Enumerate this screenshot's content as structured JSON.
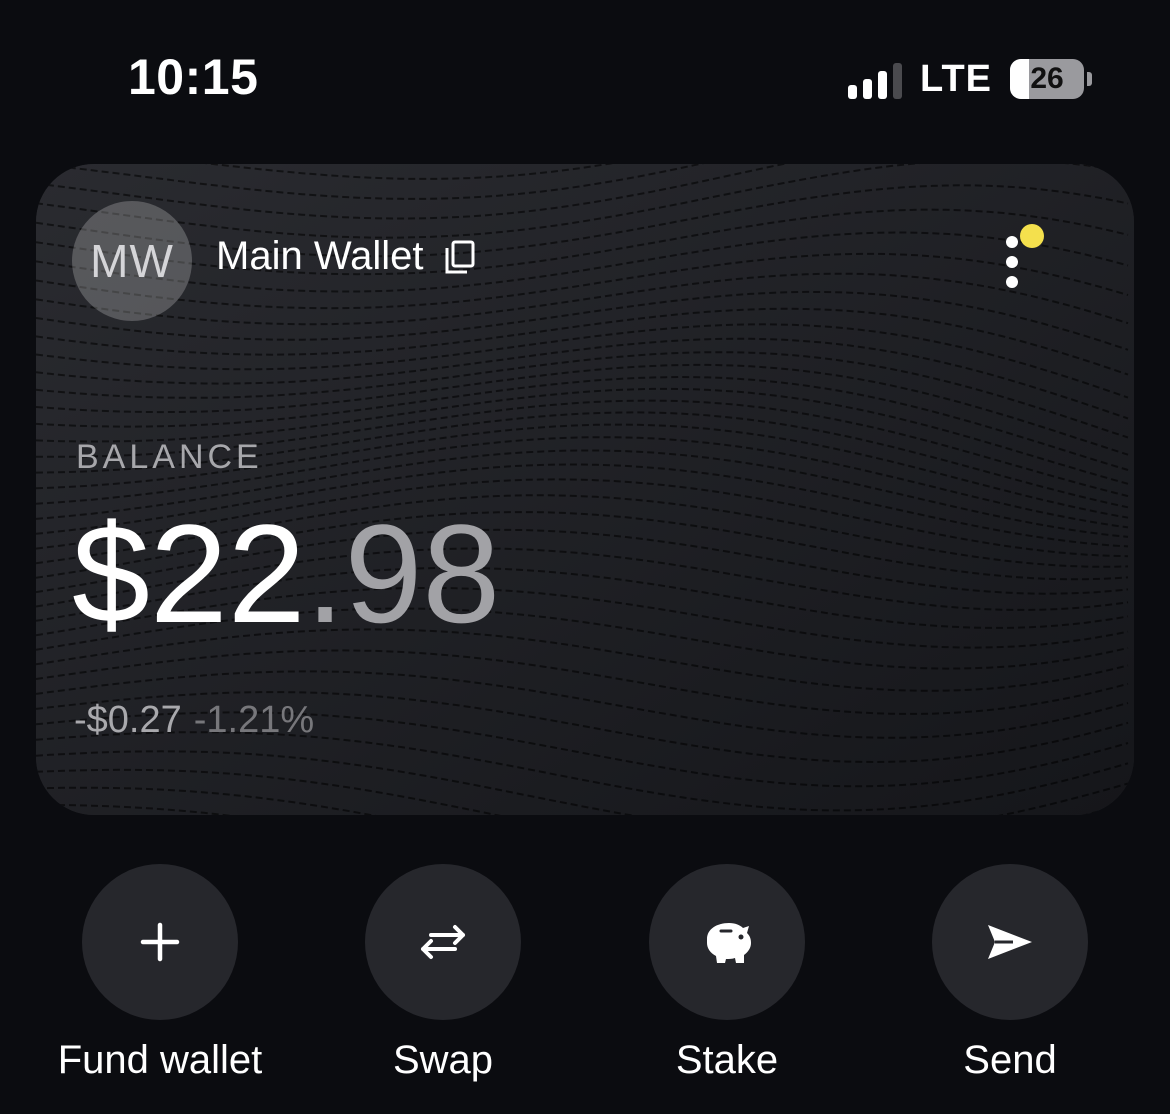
{
  "status_bar": {
    "time": "10:15",
    "network": "LTE",
    "battery_level": "26",
    "signal_bars_active": 3,
    "signal_bars_total": 4
  },
  "wallet": {
    "avatar_initials": "MW",
    "name": "Main Wallet",
    "balance_label": "BALANCE",
    "balance_dollars": "$22",
    "balance_cents": ".98",
    "change_amount": "-$0.27",
    "change_percent": "-1.21%",
    "notification_color": "#f4e04d"
  },
  "actions": [
    {
      "label": "Fund wallet",
      "icon": "plus-icon"
    },
    {
      "label": "Swap",
      "icon": "swap-arrows-icon"
    },
    {
      "label": "Stake",
      "icon": "piggy-bank-icon"
    },
    {
      "label": "Send",
      "icon": "send-icon"
    }
  ]
}
